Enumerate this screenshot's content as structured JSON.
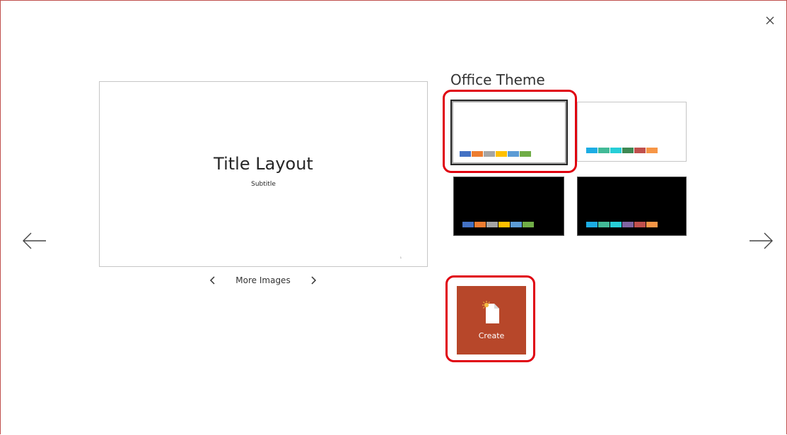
{
  "dialog": {
    "theme_name": "Office Theme",
    "close_icon": "close-icon",
    "prev_icon": "arrow-left-icon",
    "next_icon": "arrow-right-icon"
  },
  "preview": {
    "title": "Title Layout",
    "subtitle": "Subtitle",
    "slide_number": "1"
  },
  "images_nav": {
    "label": "More Images",
    "prev_icon": "chevron-left-icon",
    "next_icon": "chevron-right-icon"
  },
  "variants": [
    {
      "background": "#ffffff",
      "selected": true,
      "colors": [
        "#4472c4",
        "#ed7d31",
        "#a5a5a5",
        "#ffc000",
        "#5b9bd5",
        "#70ad47"
      ]
    },
    {
      "background": "#ffffff",
      "selected": false,
      "colors": [
        "#1cade4",
        "#42ba97",
        "#27ced7",
        "#3e8853",
        "#c0504d",
        "#f79646"
      ]
    },
    {
      "background": "#000000",
      "selected": false,
      "colors": [
        "#4472c4",
        "#ed7d31",
        "#a5a5a5",
        "#ffc000",
        "#5b9bd5",
        "#70ad47"
      ]
    },
    {
      "background": "#000000",
      "selected": false,
      "colors": [
        "#1cade4",
        "#42ba97",
        "#27ced7",
        "#8064a2",
        "#c0504d",
        "#f79646"
      ]
    }
  ],
  "create_button": {
    "label": "Create",
    "icon": "new-document-icon",
    "color": "#b7472a"
  },
  "highlight_color": "#e0000f"
}
